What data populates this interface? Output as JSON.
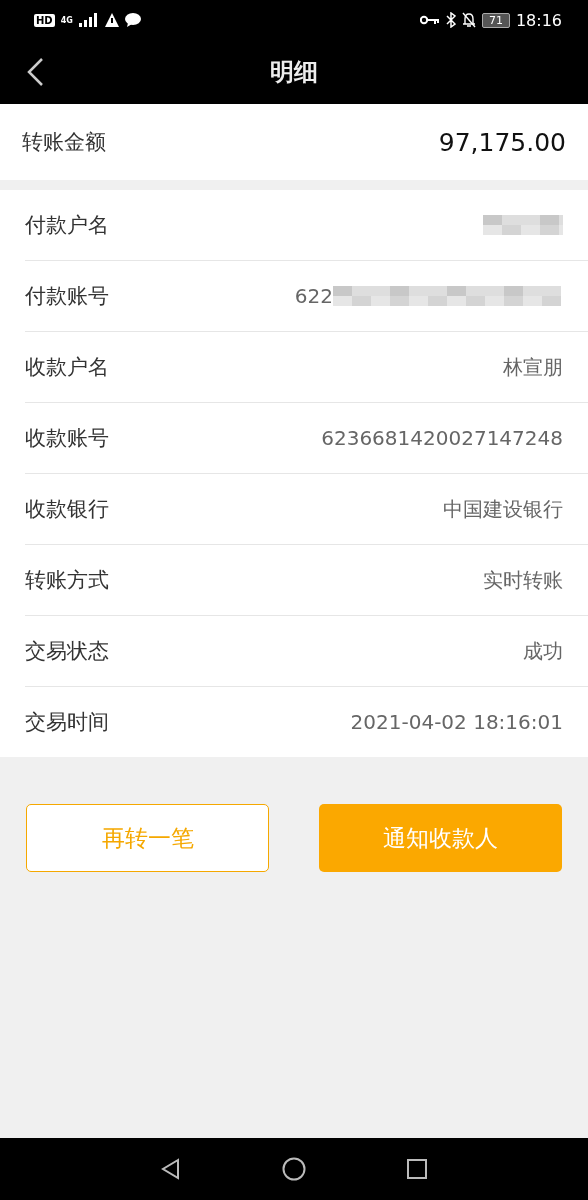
{
  "status_bar": {
    "hd": "HD",
    "network": "4G",
    "battery": "71",
    "time": "18:16"
  },
  "header": {
    "title": "明细"
  },
  "amount": {
    "label": "转账金额",
    "value": "97,175.00"
  },
  "rows": [
    {
      "label": "付款户名",
      "redacted": true
    },
    {
      "label": "付款账号",
      "value": "622",
      "redacted": true
    },
    {
      "label": "收款户名",
      "value": "林宣朋",
      "redacted": false
    },
    {
      "label": "收款账号",
      "value": "6236681420027147248",
      "redacted": false
    },
    {
      "label": "收款银行",
      "value": "中国建设银行",
      "redacted": false
    },
    {
      "label": "转账方式",
      "value": "实时转账",
      "redacted": false
    },
    {
      "label": "交易状态",
      "value": "成功",
      "redacted": false
    },
    {
      "label": "交易时间",
      "value": "2021-04-02 18:16:01",
      "redacted": false
    }
  ],
  "buttons": [
    {
      "label": "再转一笔",
      "kind": "outline"
    },
    {
      "label": "通知收款人",
      "kind": "filled"
    }
  ]
}
